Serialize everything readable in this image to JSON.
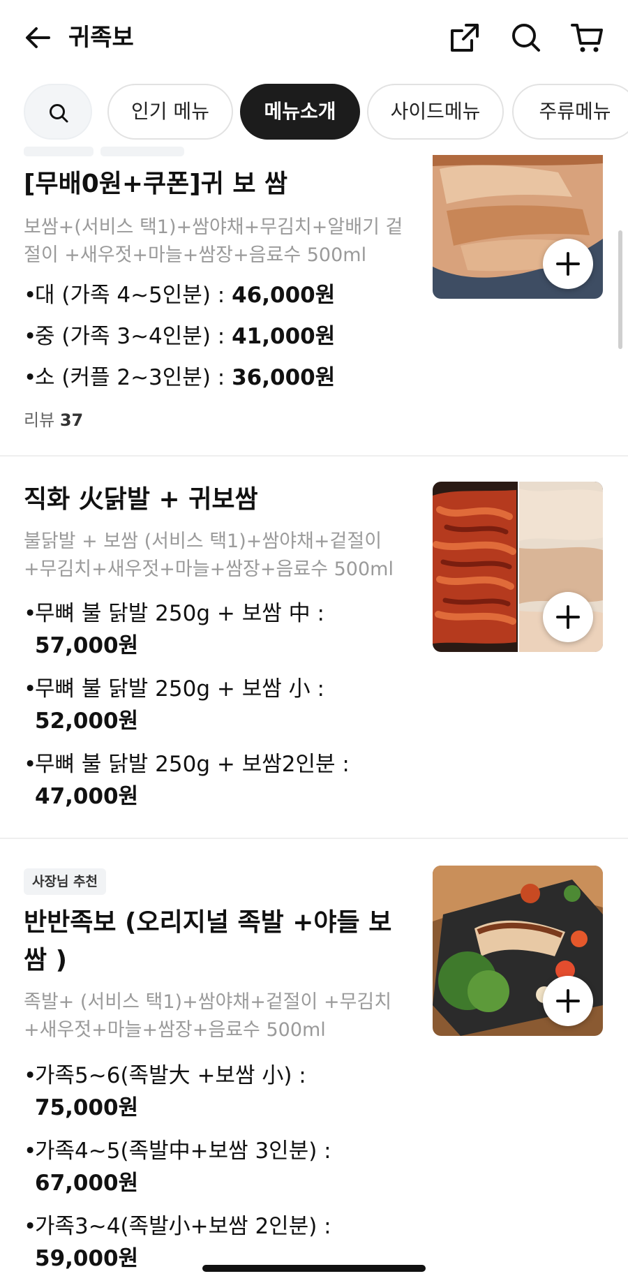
{
  "header": {
    "title": "귀족보"
  },
  "tabs": [
    {
      "label": "인기 메뉴"
    },
    {
      "label": "메뉴소개"
    },
    {
      "label": "사이드메뉴"
    },
    {
      "label": "주류메뉴"
    }
  ],
  "items": [
    {
      "name": "[무배0원+쿠폰]귀 보 쌈",
      "desc_line1": "보쌈+(서비스  택1)+쌈야채+무김치+알배기 겉",
      "desc_line2": "절이 +새우젓+마늘+쌈장+음료수 500ml",
      "options": [
        {
          "label": "대 (가족 4~5인분) : ",
          "price": "46,000원"
        },
        {
          "label": "중 (가족 3~4인분) : ",
          "price": "41,000원"
        },
        {
          "label": "소 (커플 2~3인분) : ",
          "price": "36,000원"
        }
      ],
      "review_label": "리뷰",
      "review_count": "37"
    },
    {
      "name": "직화 火닭발 + 귀보쌈",
      "desc_line1": "불닭발 + 보쌈 (서비스 택1)+쌈야채+겉절이",
      "desc_line2": "+무김치+새우젓+마늘+쌈장+음료수 500ml",
      "options": [
        {
          "label": "무뼈 불 닭발 250g + 보쌈 中 :",
          "price": "57,000원"
        },
        {
          "label": "무뼈 불 닭발 250g + 보쌈 小 :",
          "price": "52,000원"
        },
        {
          "label": "무뼈 불 닭발 250g + 보쌈2인분 :",
          "price": "47,000원"
        }
      ]
    },
    {
      "badge": "사장님 추천",
      "name_line1": "반반족보 (오리지널 족발 +야들 보",
      "name_line2": "쌈 )",
      "desc_line1": "족발+ (서비스 택1)+쌈야채+겉절이 +무김치",
      "desc_line2": "+새우젓+마늘+쌈장+음료수 500ml",
      "options": [
        {
          "label": "가족5~6(족발大 +보쌈 小) :",
          "price": "75,000원"
        },
        {
          "label": "가족4~5(족발中+보쌈 3인분) :",
          "price": "67,000원"
        },
        {
          "label": "가족3~4(족발小+보쌈 2인분) :",
          "price": "59,000원"
        }
      ]
    }
  ]
}
